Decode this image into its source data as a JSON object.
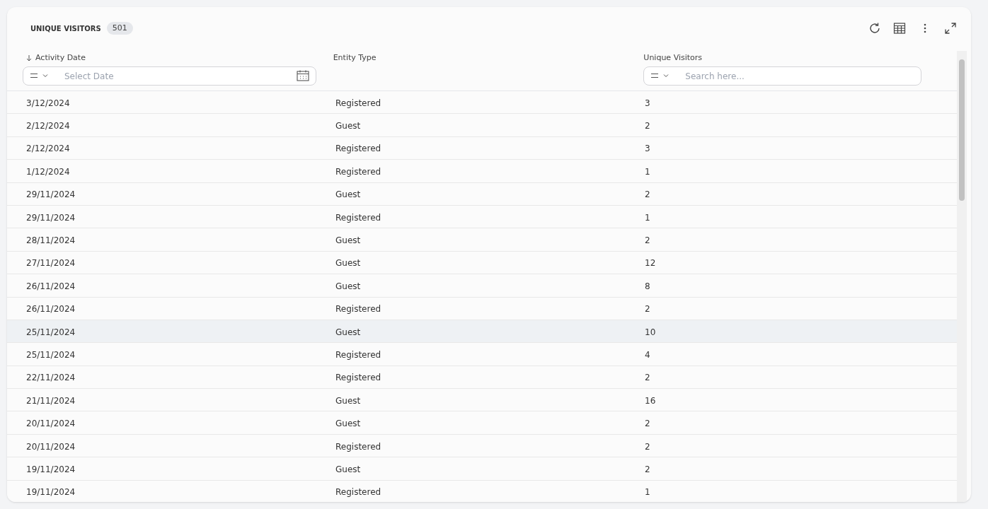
{
  "header": {
    "title": "UNIQUE VISITORS",
    "count": "501"
  },
  "columns": [
    {
      "label": "Activity Date",
      "sorted": true,
      "filter": {
        "kind": "date",
        "placeholder": "Select Date"
      }
    },
    {
      "label": "Entity Type",
      "sorted": false
    },
    {
      "label": "Unique Visitors",
      "sorted": false,
      "filter": {
        "kind": "text",
        "placeholder": "Search here..."
      }
    }
  ],
  "rows": [
    {
      "cells": [
        "3/12/2024",
        "Registered",
        "3"
      ],
      "highlighted": false
    },
    {
      "cells": [
        "2/12/2024",
        "Guest",
        "2"
      ],
      "highlighted": false
    },
    {
      "cells": [
        "2/12/2024",
        "Registered",
        "3"
      ],
      "highlighted": false
    },
    {
      "cells": [
        "1/12/2024",
        "Registered",
        "1"
      ],
      "highlighted": false
    },
    {
      "cells": [
        "29/11/2024",
        "Guest",
        "2"
      ],
      "highlighted": false
    },
    {
      "cells": [
        "29/11/2024",
        "Registered",
        "1"
      ],
      "highlighted": false
    },
    {
      "cells": [
        "28/11/2024",
        "Guest",
        "2"
      ],
      "highlighted": false
    },
    {
      "cells": [
        "27/11/2024",
        "Guest",
        "12"
      ],
      "highlighted": false
    },
    {
      "cells": [
        "26/11/2024",
        "Guest",
        "8"
      ],
      "highlighted": false
    },
    {
      "cells": [
        "26/11/2024",
        "Registered",
        "2"
      ],
      "highlighted": false
    },
    {
      "cells": [
        "25/11/2024",
        "Guest",
        "10"
      ],
      "highlighted": true
    },
    {
      "cells": [
        "25/11/2024",
        "Registered",
        "4"
      ],
      "highlighted": false
    },
    {
      "cells": [
        "22/11/2024",
        "Registered",
        "2"
      ],
      "highlighted": false
    },
    {
      "cells": [
        "21/11/2024",
        "Guest",
        "16"
      ],
      "highlighted": false
    },
    {
      "cells": [
        "20/11/2024",
        "Guest",
        "2"
      ],
      "highlighted": false
    },
    {
      "cells": [
        "20/11/2024",
        "Registered",
        "2"
      ],
      "highlighted": false
    },
    {
      "cells": [
        "19/11/2024",
        "Guest",
        "2"
      ],
      "highlighted": false
    },
    {
      "cells": [
        "19/11/2024",
        "Registered",
        "1"
      ],
      "highlighted": false
    }
  ]
}
